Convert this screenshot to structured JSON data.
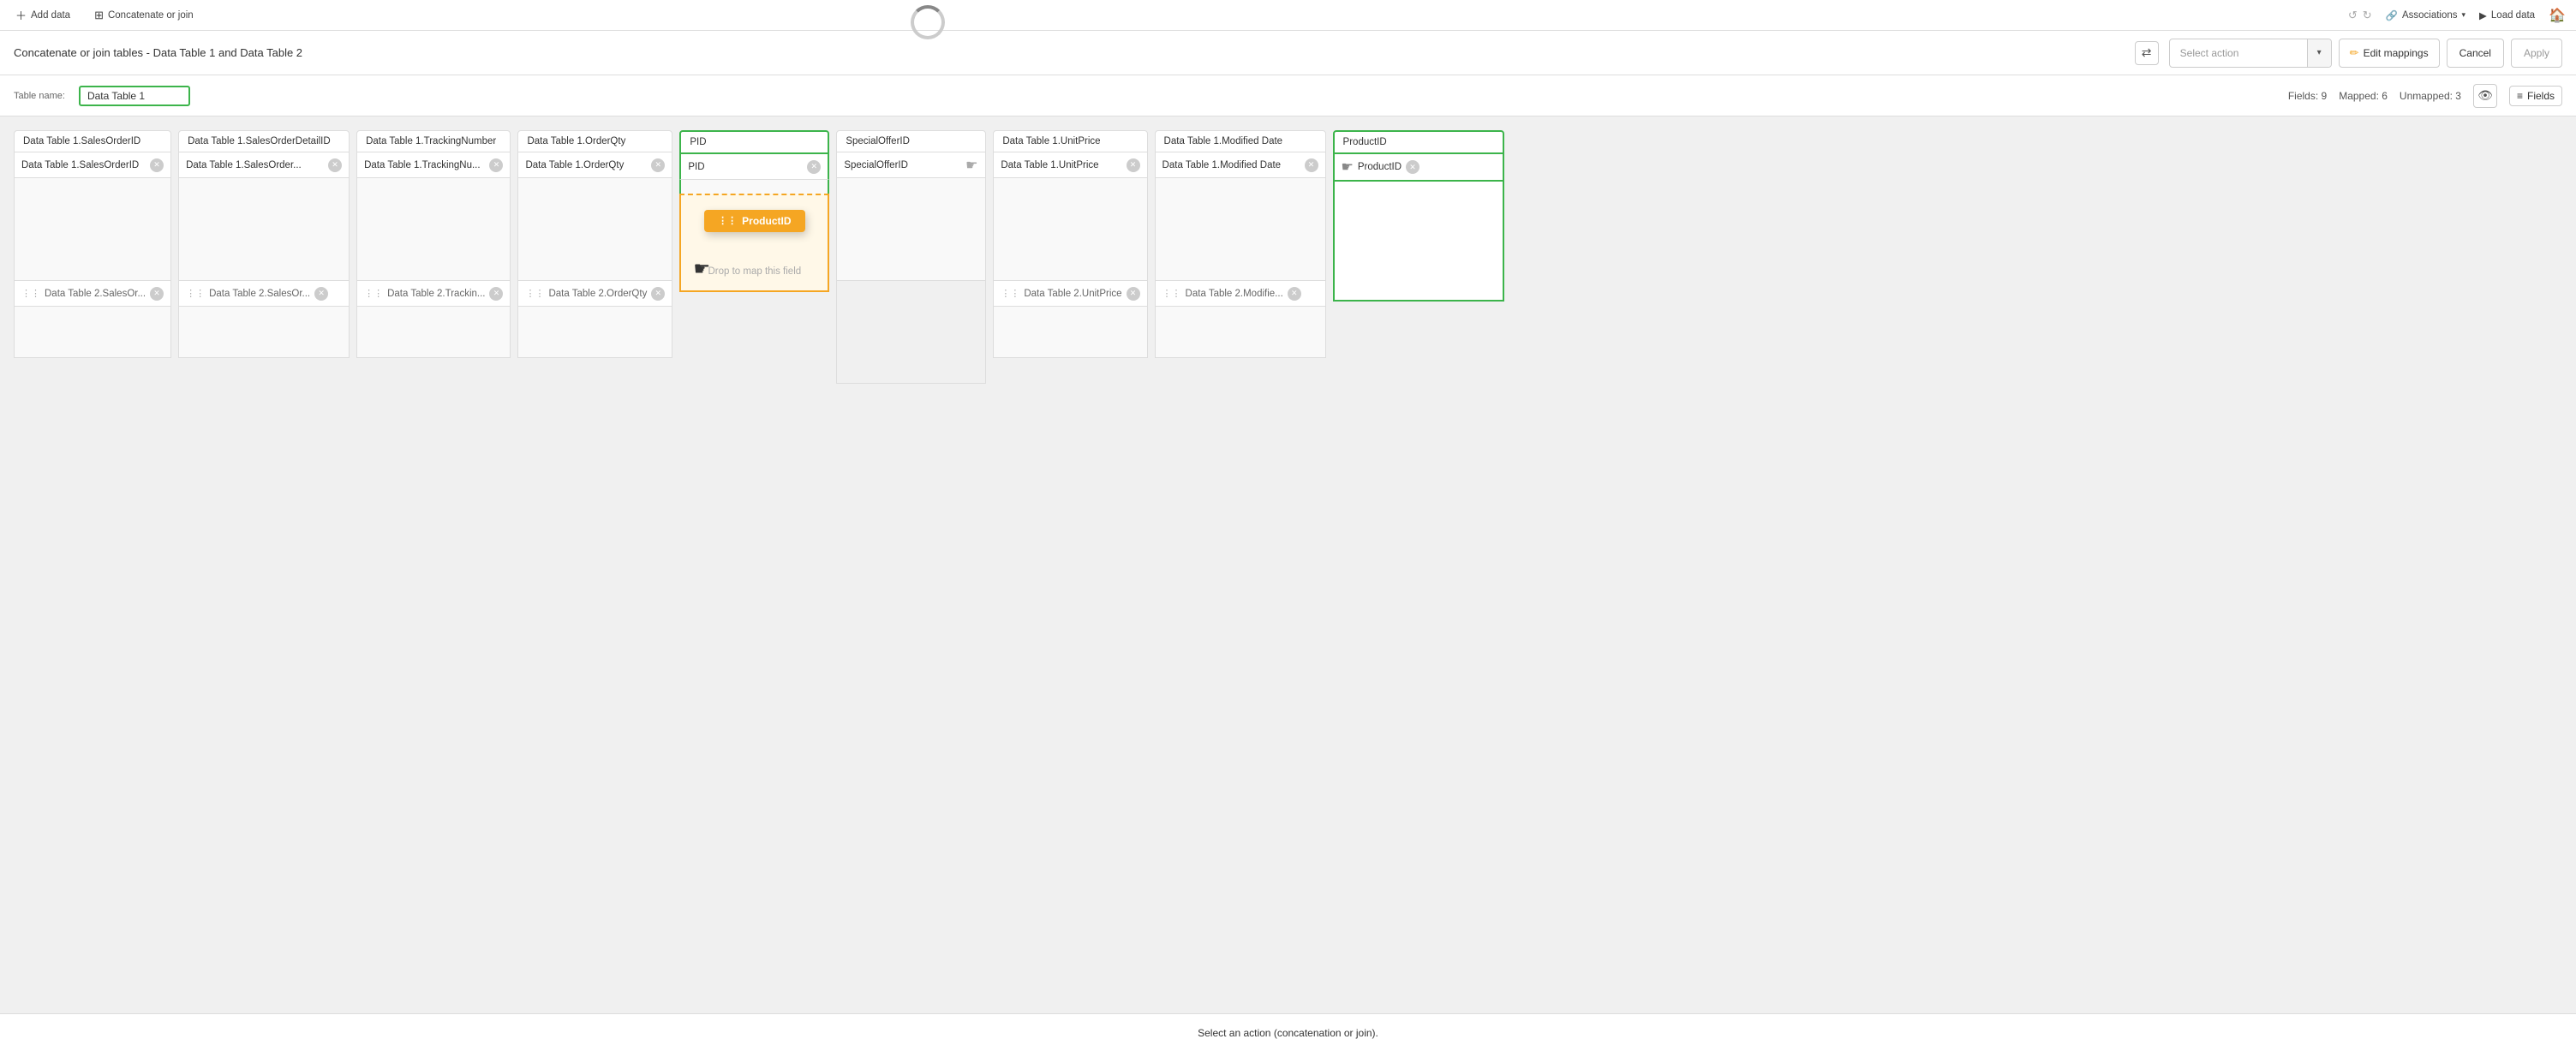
{
  "topToolbar": {
    "addData": "Add data",
    "concatenateJoin": "Concatenate or join",
    "undoTitle": "Undo",
    "redoTitle": "Redo",
    "associations": "Associations",
    "loadData": "Load data",
    "homeIcon": "🏠"
  },
  "actionBar": {
    "title": "Concatenate or join tables - Data Table 1 and Data Table 2",
    "swapIcon": "⇄",
    "selectActionPlaceholder": "Select action",
    "editMappings": "Edit mappings",
    "cancel": "Cancel",
    "apply": "Apply"
  },
  "tableNameSection": {
    "label": "Table name:",
    "value": "Data Table 1",
    "fieldsInfo": "Fields: 9",
    "mappedInfo": "Mapped: 6",
    "unmappedInfo": "Unmapped: 3",
    "fieldsLabel": "Fields"
  },
  "columns": [
    {
      "id": "col1",
      "header": "Data Table 1.SalesOrderID",
      "row1": "Data Table 1.SalesOrderID",
      "row2": "Data Table 2.SalesOr...",
      "highlighted": false
    },
    {
      "id": "col2",
      "header": "Data Table 1.SalesOrderDetailID",
      "row1": "Data Table 1.SalesOrder...",
      "row2": "Data Table 2.SalesOr...",
      "highlighted": false
    },
    {
      "id": "col3",
      "header": "Data Table 1.TrackingNumber",
      "row1": "Data Table 1.TrackingNu...",
      "row2": "Data Table 2.Trackin...",
      "highlighted": false
    },
    {
      "id": "col4",
      "header": "Data Table 1.OrderQty",
      "row1": "Data Table 1.OrderQty",
      "row2": "Data Table 2.OrderQty",
      "highlighted": false
    },
    {
      "id": "col5",
      "header": "PID",
      "row1": "PID",
      "row2": null,
      "highlighted": true,
      "dropZone": true,
      "dragItem": "ProductID",
      "dropText": "Drop to map this field"
    },
    {
      "id": "col6",
      "header": "SpecialOfferID",
      "row1": "SpecialOfferID",
      "row2": null,
      "highlighted": false,
      "emptyRow2": true
    },
    {
      "id": "col7",
      "header": "Data Table 1.UnitPrice",
      "row1": "Data Table 1.UnitPrice",
      "row2": "Data Table 2.UnitPrice",
      "highlighted": false
    },
    {
      "id": "col8",
      "header": "Data Table 1.Modified Date",
      "row1": "Data Table 1.Modified Date",
      "row2": "Data Table 2.Modifie...",
      "highlighted": false
    },
    {
      "id": "col9",
      "header": "ProductID",
      "row1": "ProductID",
      "row2": null,
      "highlighted": true,
      "productIdCol": true
    }
  ],
  "bottomStatus": {
    "text": "Select an action (concatenation or join)."
  },
  "colors": {
    "green": "#3cb44b",
    "orange": "#f5a623"
  }
}
